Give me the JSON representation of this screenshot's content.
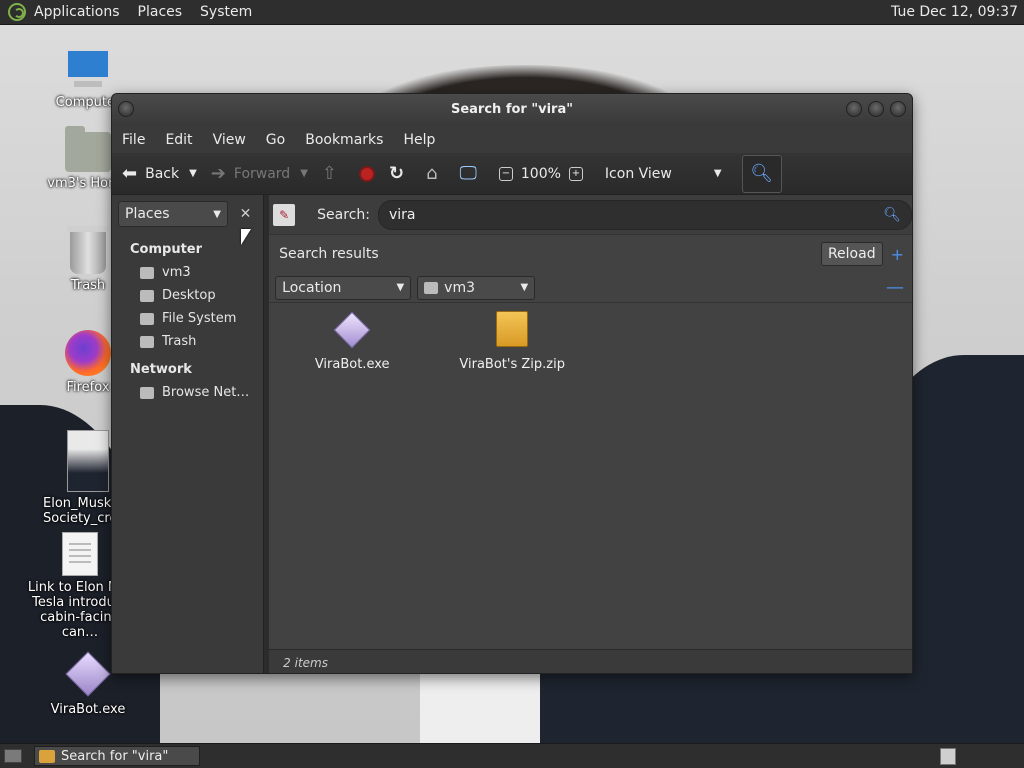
{
  "top_panel": {
    "menus": [
      "Applications",
      "Places",
      "System"
    ],
    "clock": "Tue Dec 12, 09:37"
  },
  "desktop": {
    "icons": [
      {
        "label": "Computer"
      },
      {
        "label": "vm3's Home"
      },
      {
        "label": "Trash"
      },
      {
        "label": "Firefox"
      },
      {
        "label": "Elon_Musk_R… Society_crop…"
      },
      {
        "label": "Link to Elon M… Tesla introdu… cabin-facing can…"
      },
      {
        "label": "ViraBot.exe"
      }
    ]
  },
  "window": {
    "title": "Search for \"vira\"",
    "menubar": [
      "File",
      "Edit",
      "View",
      "Go",
      "Bookmarks",
      "Help"
    ],
    "toolbar": {
      "back": "Back",
      "forward": "Forward",
      "zoom": "100%",
      "view_mode": "Icon View"
    },
    "sidebar": {
      "selector": "Places",
      "sections": [
        {
          "title": "Computer",
          "items": [
            "vm3",
            "Desktop",
            "File System",
            "Trash"
          ]
        },
        {
          "title": "Network",
          "items": [
            "Browse Net…"
          ]
        }
      ]
    },
    "search": {
      "label": "Search:",
      "query": "vira",
      "results_title": "Search results",
      "reload": "Reload",
      "criteria_type": "Location",
      "criteria_value": "vm3"
    },
    "files": [
      {
        "name": "ViraBot.exe",
        "kind": "exe"
      },
      {
        "name": "ViraBot's Zip.zip",
        "kind": "zip"
      }
    ],
    "status": "2 items"
  },
  "bottom_panel": {
    "task": "Search for \"vira\""
  }
}
